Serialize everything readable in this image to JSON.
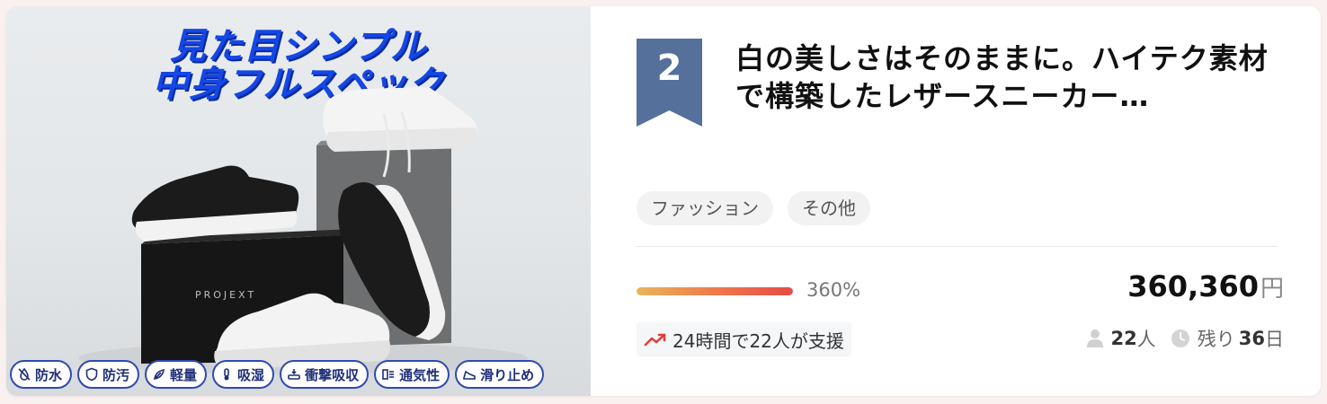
{
  "image": {
    "headline_line1": "見た目シンプル",
    "headline_line2": "中身フルスペック",
    "box_brand": "PROJEXT",
    "features": [
      {
        "icon": "no-water-icon",
        "label": "防水"
      },
      {
        "icon": "shield-icon",
        "label": "防汚"
      },
      {
        "icon": "feather-icon",
        "label": "軽量"
      },
      {
        "icon": "thermometer-icon",
        "label": "吸湿"
      },
      {
        "icon": "cushion-icon",
        "label": "衝撃吸収"
      },
      {
        "icon": "vent-icon",
        "label": "通気性"
      },
      {
        "icon": "shoe-grip-icon",
        "label": "滑り止め"
      }
    ]
  },
  "rank": "2",
  "title": "白の美しさはそのままに。ハイテク素材で構築したレザースニーカー…",
  "tags": [
    "ファッション",
    "その他"
  ],
  "progress": {
    "percent_label": "360%",
    "fill_fraction": 1.0
  },
  "amount": {
    "value": "360,360",
    "unit": "円"
  },
  "trend": {
    "text": "24時間で22人が支援"
  },
  "supporters": {
    "count": "22",
    "unit": "人"
  },
  "remaining": {
    "prefix": "残り",
    "days": "36",
    "unit": "日"
  },
  "colors": {
    "rank_ribbon": "#55709a",
    "headline": "#1447e6",
    "badge_border": "#2f4ab0",
    "trend_icon": "#e0403c",
    "progress_start": "#eab55a",
    "progress_end": "#e74a46"
  }
}
